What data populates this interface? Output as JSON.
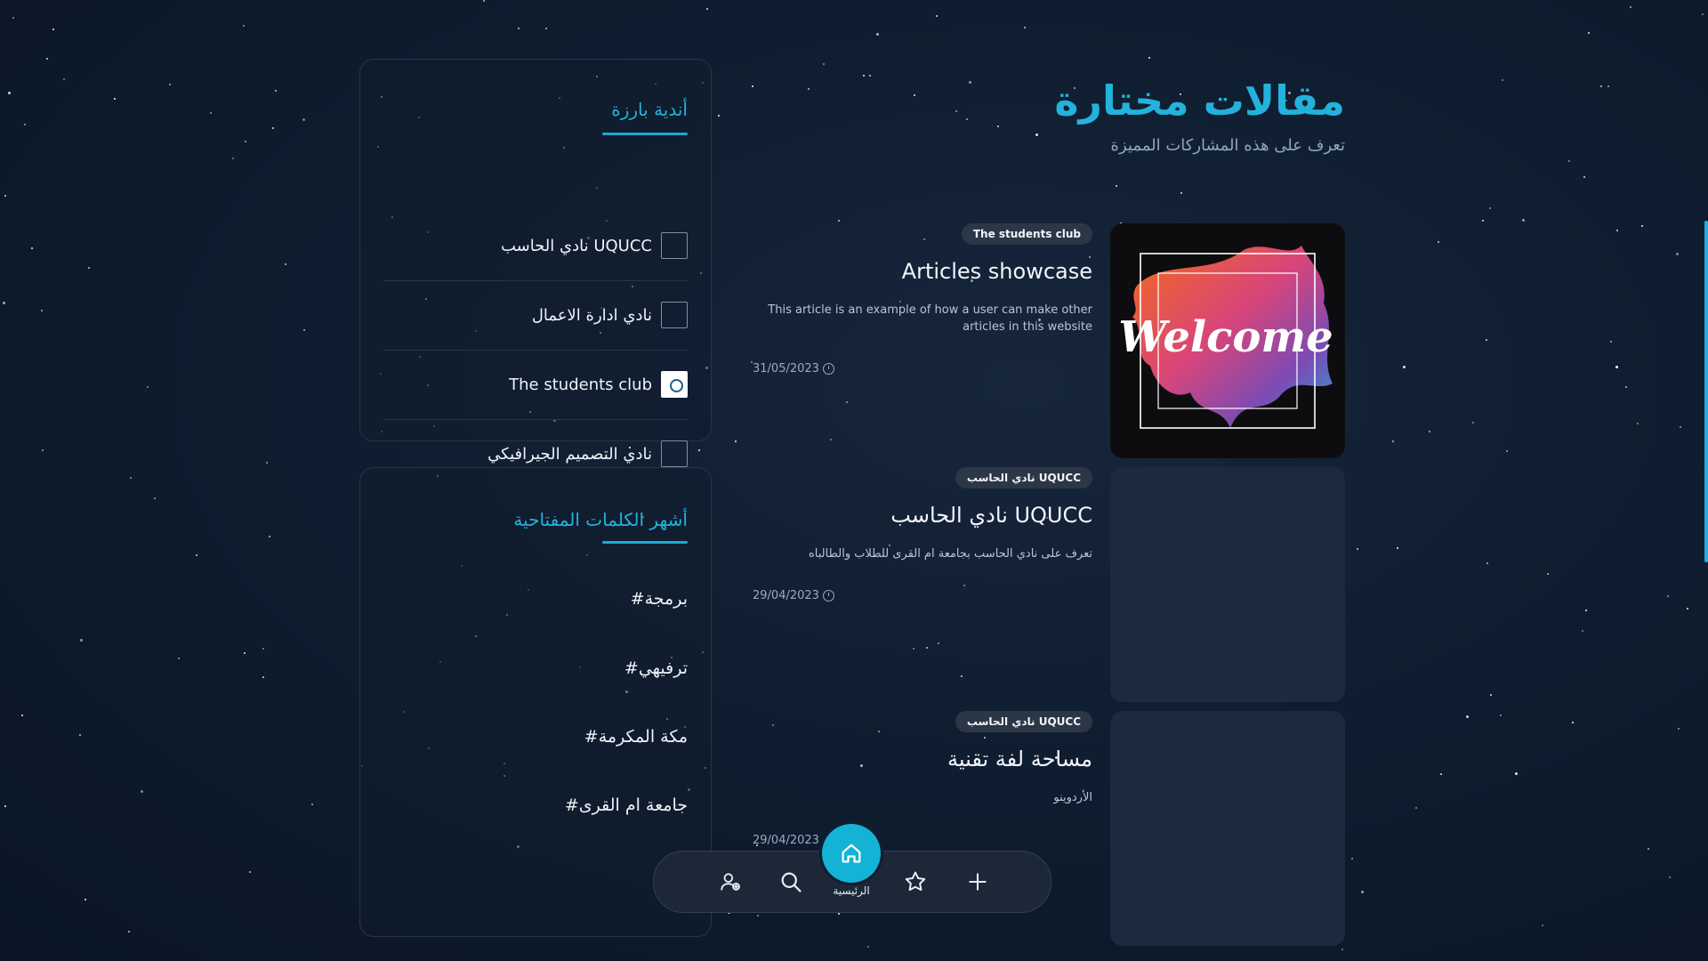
{
  "featured": {
    "title": "مقالات مختارة",
    "subtitle": "تعرف على هذه المشاركات المميزة",
    "articles": [
      {
        "club": "The students club",
        "title": "Articles showcase",
        "excerpt": "This article is an example of how a user can make other articles in this website",
        "date": "31/05/2023",
        "image_text": "Welcome"
      },
      {
        "club": "نادي الحاسب UQUCC",
        "title": "نادي الحاسب UQUCC",
        "excerpt": "تعرف على نادي الحاسب بجامعة ام القرى للطلاب والطالباه",
        "date": "29/04/2023"
      },
      {
        "club": "نادي الحاسب UQUCC",
        "title": "مساحة لفة تقنية",
        "excerpt": "الأردوينو",
        "date": "29/04/2023"
      }
    ]
  },
  "clubs_panel": {
    "title": "أندية بارزة",
    "items": [
      {
        "name": "نادي الحاسب UQUCC"
      },
      {
        "name": "نادي ادارة الاعمال"
      },
      {
        "name": "The students club"
      },
      {
        "name": "نادي التصميم الجيرافيكي"
      }
    ]
  },
  "tags_panel": {
    "title": "أشهر الكلمات المفتاحية",
    "tags": [
      "#برمجة",
      "#ترفيهي",
      "#مكة المكرمة",
      "#جامعة ام القرى"
    ]
  },
  "bottom_nav": {
    "home_label": "الرئيسية",
    "items": [
      "add-user-icon",
      "search-icon",
      "home-icon",
      "star-icon",
      "plus-icon"
    ]
  },
  "colors": {
    "accent": "#23b2dc",
    "background": "#0f1d30",
    "card": "#1b2a3f"
  }
}
